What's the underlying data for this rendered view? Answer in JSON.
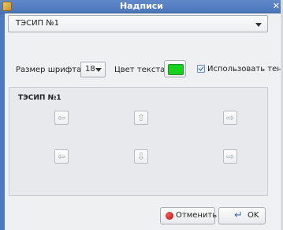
{
  "window": {
    "title": "Надписи",
    "close_glyph": "✕",
    "app_icon": "app-icon"
  },
  "source_select": {
    "value": "ТЭСИП №1"
  },
  "font_size": {
    "label": "Размер шрифта:",
    "value": "18"
  },
  "text_color": {
    "label": "Цвет текста:",
    "color": "#19d11f"
  },
  "shadow": {
    "label": "Использовать тень",
    "checked": true
  },
  "preview": {
    "title": "ТЭСИП №1",
    "buttons": [
      {
        "name": "arrow-left-top",
        "glyph": "⇦"
      },
      {
        "name": "arrow-up",
        "glyph": "⇧"
      },
      {
        "name": "arrow-right-top",
        "glyph": "⇨"
      },
      {
        "name": "arrow-left-bottom",
        "glyph": "⇦"
      },
      {
        "name": "arrow-down",
        "glyph": "⇩"
      },
      {
        "name": "arrow-right-bottom",
        "glyph": "⇨"
      }
    ]
  },
  "actions": {
    "cancel_label": "Отменить",
    "ok_label": "OK",
    "ok_icon": "↵"
  }
}
